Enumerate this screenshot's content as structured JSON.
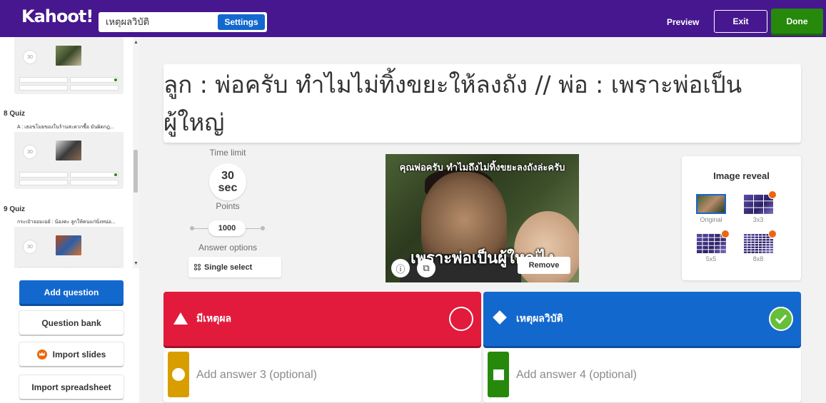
{
  "topbar": {
    "logo": "Kahoot!",
    "title_value": "เหตุผลวิบัติ",
    "settings_label": "Settings",
    "preview_label": "Preview",
    "exit_label": "Exit",
    "done_label": "Done"
  },
  "sidebar": {
    "slides": [
      {
        "time": "30"
      },
      {
        "number_label": "8 Quiz",
        "question": "A : เธอขโมยของในร้านสะดวกซื้อ มันผิดกฎ...",
        "time": "30"
      },
      {
        "number_label": "9 Quiz",
        "question": "กระเป๋าจอมเฉย์ : น้องคะ ลูกให้คนแก่นั่งหน่อ...",
        "time": "30"
      }
    ],
    "add_question_label": "Add question",
    "question_bank_label": "Question bank",
    "import_slides_label": "Import slides",
    "import_spreadsheet_label": "Import spreadsheet"
  },
  "question": {
    "text": "ลูก : พ่อครับ ทำไมไม่ทิ้งขยะให้ลงถัง // พ่อ : เพราะพ่อเป็นผู้ใหญ่"
  },
  "settings": {
    "time_limit_label": "Time limit",
    "time_value": "30",
    "time_unit": "sec",
    "points_label": "Points",
    "points_value": "1000",
    "answer_options_label": "Answer options",
    "answer_options_value": "Single select"
  },
  "media": {
    "caption_top": "คุณพ่อครับ ทำไมถึงไม่ทิ้งขยะลงถังล่ะครับ",
    "caption_bottom": "เพราะพ่อเป็นผู้ใหญ่ไง",
    "remove_label": "Remove"
  },
  "image_reveal": {
    "title": "Image reveal",
    "options": [
      "Original",
      "3x3",
      "5x5",
      "8x8"
    ],
    "selected": "Original"
  },
  "answers": [
    {
      "text": "มีเหตุผล",
      "shape": "triangle",
      "color": "#e21b3c",
      "correct": false
    },
    {
      "text": "เหตุผลวิบัติ",
      "shape": "diamond",
      "color": "#1368ce",
      "correct": true
    },
    {
      "placeholder": "Add answer 3 (optional)",
      "shape": "circle",
      "color": "#d89e00"
    },
    {
      "placeholder": "Add answer 4 (optional)",
      "shape": "square",
      "color": "#26890c"
    }
  ]
}
